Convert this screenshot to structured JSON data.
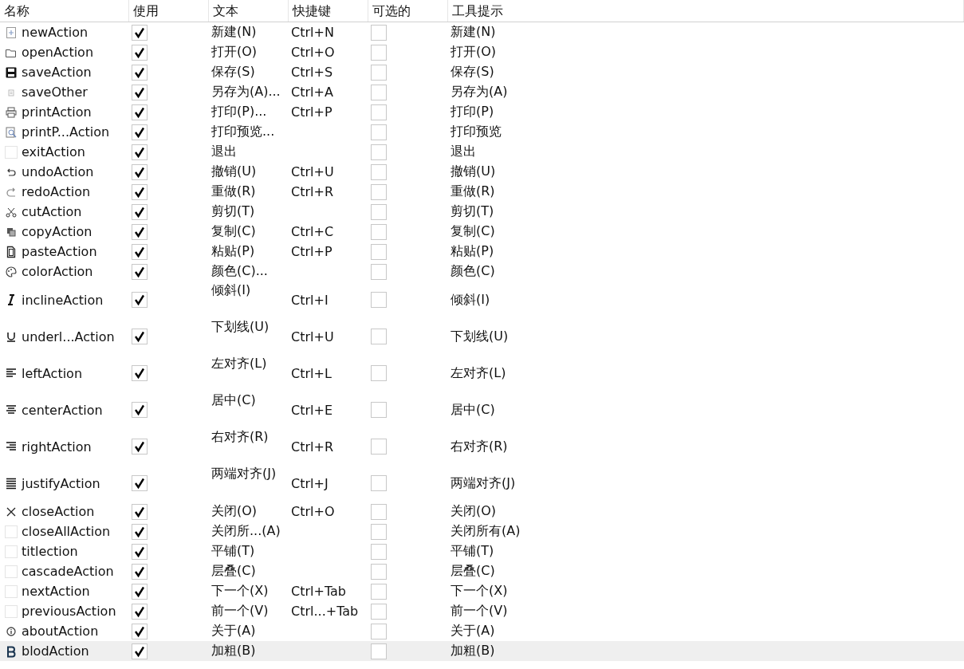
{
  "table": {
    "columns": [
      "名称",
      "使用",
      "文本",
      "快捷键",
      "可选的",
      "工具提示"
    ],
    "rows": [
      {
        "name": "newAction",
        "used": true,
        "text": "新建(N)",
        "shortcut": "Ctrl+N",
        "checkable": false,
        "tooltip": "新建(N)",
        "kind": "normal",
        "selected": false
      },
      {
        "name": "openAction",
        "used": true,
        "text": "打开(O)",
        "shortcut": "Ctrl+O",
        "checkable": false,
        "tooltip": "打开(O)",
        "kind": "normal",
        "selected": false
      },
      {
        "name": "saveAction",
        "used": true,
        "text": "保存(S)",
        "shortcut": "Ctrl+S",
        "checkable": false,
        "tooltip": "保存(S)",
        "kind": "normal",
        "selected": false
      },
      {
        "name": "saveOther",
        "used": true,
        "text": "另存为(A)...",
        "shortcut": "Ctrl+A",
        "checkable": false,
        "tooltip": "另存为(A)",
        "kind": "normal",
        "selected": false
      },
      {
        "name": "printAction",
        "used": true,
        "text": "打印(P)...",
        "shortcut": "Ctrl+P",
        "checkable": false,
        "tooltip": "打印(P)",
        "kind": "normal",
        "selected": false
      },
      {
        "name": "printP...Action",
        "used": true,
        "text": "打印预览...",
        "checkable": false,
        "tooltip": "打印预览",
        "kind": "normal",
        "selected": false
      },
      {
        "name": "exitAction",
        "used": true,
        "text": "退出",
        "checkable": false,
        "tooltip": "退出",
        "kind": "normal",
        "selected": false
      },
      {
        "name": "undoAction",
        "used": true,
        "text": "撤销(U)",
        "shortcut": "Ctrl+U",
        "checkable": false,
        "tooltip": "撤销(U)",
        "kind": "normal",
        "selected": false
      },
      {
        "name": "redoAction",
        "used": true,
        "text": "重做(R)",
        "shortcut": "Ctrl+R",
        "checkable": false,
        "tooltip": "重做(R)",
        "kind": "normal",
        "selected": false
      },
      {
        "name": "cutAction",
        "used": true,
        "text": "剪切(T)",
        "checkable": false,
        "tooltip": "剪切(T)",
        "kind": "normal",
        "selected": false
      },
      {
        "name": "copyAction",
        "used": true,
        "text": "复制(C)",
        "shortcut": "Ctrl+C",
        "checkable": false,
        "tooltip": "复制(C)",
        "kind": "normal",
        "selected": false
      },
      {
        "name": "pasteAction",
        "used": true,
        "text": "粘贴(P)",
        "shortcut": "Ctrl+P",
        "checkable": false,
        "tooltip": "粘贴(P)",
        "kind": "normal",
        "selected": false
      },
      {
        "name": "colorAction",
        "used": true,
        "text": "颜色(C)...",
        "checkable": false,
        "tooltip": "颜色(C)",
        "kind": "normal",
        "selected": false
      },
      {
        "name": "inclineAction",
        "used": true,
        "text": "倾斜(I)",
        "shortcut": "Ctrl+I",
        "checkable": false,
        "tooltip": "倾斜(I)",
        "kind": "tall",
        "selected": false
      },
      {
        "name": "underl...Action",
        "used": true,
        "text": "下划线(U)",
        "shortcut": "Ctrl+U",
        "checkable": false,
        "tooltip": "下划线(U)",
        "kind": "tall",
        "selected": false
      },
      {
        "name": "leftAction",
        "used": true,
        "text": "左对齐(L)",
        "shortcut": "Ctrl+L",
        "checkable": false,
        "tooltip": "左对齐(L)",
        "kind": "tall",
        "selected": false
      },
      {
        "name": "centerAction",
        "used": true,
        "text": "居中(C)",
        "shortcut": "Ctrl+E",
        "checkable": false,
        "tooltip": "居中(C)",
        "kind": "tall",
        "selected": false
      },
      {
        "name": "rightAction",
        "used": true,
        "text": "右对齐(R)",
        "shortcut": "Ctrl+R",
        "checkable": false,
        "tooltip": "右对齐(R)",
        "kind": "tall",
        "selected": false
      },
      {
        "name": "justifyAction",
        "used": true,
        "text": "两端对齐(J)",
        "shortcut": "Ctrl+J",
        "checkable": false,
        "tooltip": "两端对齐(J)",
        "kind": "tall",
        "selected": false
      },
      {
        "name": "closeAction",
        "used": true,
        "text": "关闭(O)",
        "shortcut": "Ctrl+O",
        "checkable": false,
        "tooltip": "关闭(O)",
        "kind": "normal",
        "selected": false
      },
      {
        "name": "closeAllAction",
        "used": true,
        "text": "关闭所...(A)",
        "checkable": false,
        "tooltip": "关闭所有(A)",
        "kind": "normal",
        "selected": false
      },
      {
        "name": "titlection",
        "used": true,
        "text": "平铺(T)",
        "checkable": false,
        "tooltip": "平铺(T)",
        "kind": "normal",
        "selected": false
      },
      {
        "name": "cascadeAction",
        "used": true,
        "text": "层叠(C)",
        "checkable": false,
        "tooltip": "层叠(C)",
        "kind": "normal",
        "selected": false
      },
      {
        "name": "nextAction",
        "used": true,
        "text": "下一个(X)",
        "shortcut": "Ctrl+Tab",
        "checkable": false,
        "tooltip": "下一个(X)",
        "kind": "normal",
        "selected": false
      },
      {
        "name": "previousAction",
        "used": true,
        "text": "前一个(V)",
        "shortcut": "Ctrl...+Tab",
        "checkable": false,
        "tooltip": "前一个(V)",
        "kind": "normal",
        "selected": false
      },
      {
        "name": "aboutAction",
        "used": true,
        "text": "关于(A)",
        "checkable": false,
        "tooltip": "关于(A)",
        "kind": "normal",
        "selected": false
      },
      {
        "name": "blodAction",
        "used": true,
        "text": "加粗(B)",
        "checkable": false,
        "tooltip": "加粗(B)",
        "kind": "normal",
        "selected": true
      }
    ]
  }
}
